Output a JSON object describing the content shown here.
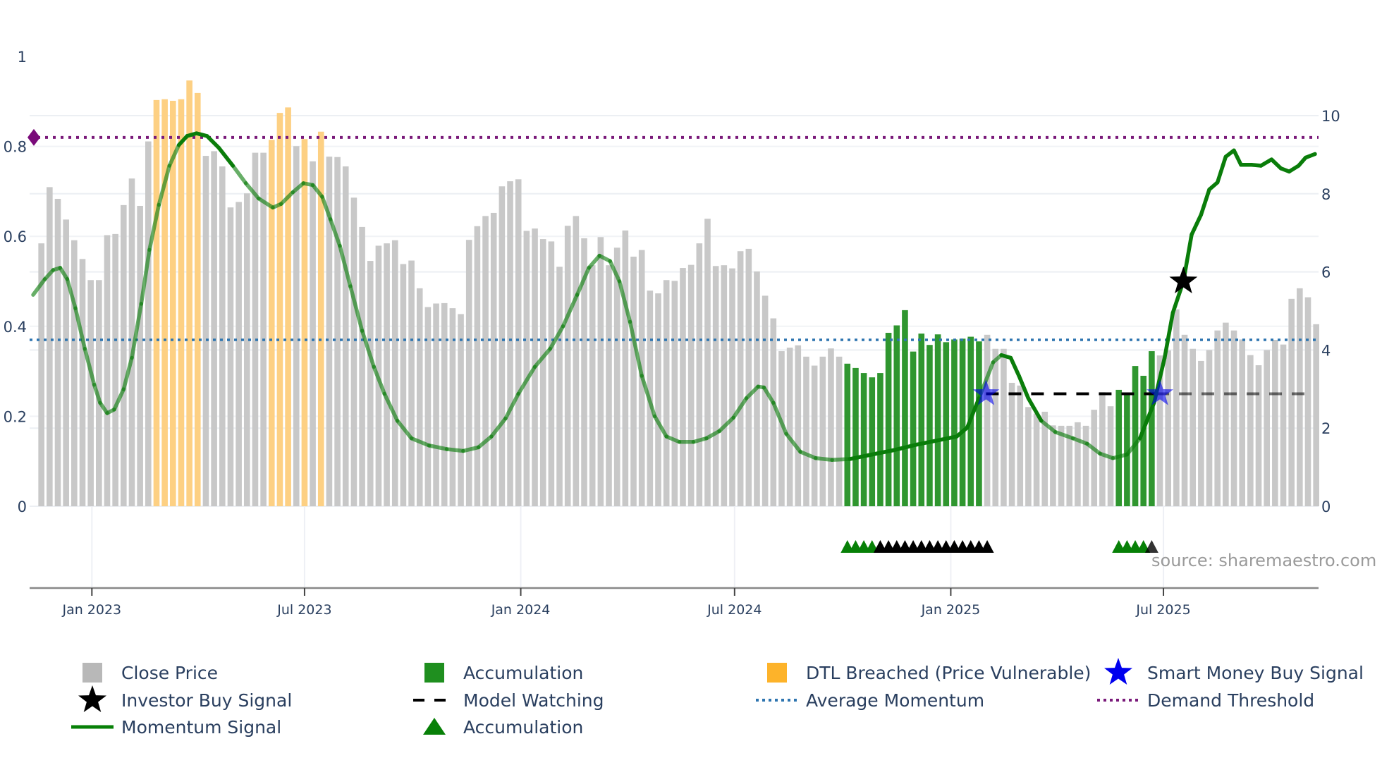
{
  "chart_data": {
    "type": "bar",
    "title": "",
    "source_note": "source: sharemaestro.com",
    "x_range": [
      "2022-11-09",
      "2025-11-10"
    ],
    "x_ticks": [
      {
        "date": "2023-01-01",
        "label": "Jan 2023"
      },
      {
        "date": "2023-07-01",
        "label": "Jul 2023"
      },
      {
        "date": "2024-01-01",
        "label": "Jan 2024"
      },
      {
        "date": "2024-07-01",
        "label": "Jul 2024"
      },
      {
        "date": "2025-01-01",
        "label": "Jan 2025"
      },
      {
        "date": "2025-07-01",
        "label": "Jul 2025"
      }
    ],
    "y_left": {
      "range": [
        0,
        1
      ],
      "ticks": [
        0,
        0.2,
        0.4,
        0.6,
        0.8,
        1
      ],
      "tick_labels": [
        "0",
        "0.2",
        "0.4",
        "0.6",
        "0.8",
        "1"
      ]
    },
    "y_right": {
      "range": [
        0,
        11.5
      ],
      "ticks": [
        0,
        2,
        4,
        6,
        8,
        10
      ],
      "tick_labels": [
        "0",
        "2",
        "4",
        "6",
        "8",
        "10"
      ]
    },
    "close_price": {
      "axis": "right",
      "start_date": "2022-11-19",
      "step_days": 7,
      "values": [
        6.73,
        8.17,
        7.87,
        7.34,
        6.81,
        6.33,
        5.79,
        5.79,
        6.94,
        6.97,
        7.71,
        8.39,
        7.69,
        9.34,
        10.4,
        10.42,
        10.38,
        10.42,
        10.9,
        10.58,
        8.97,
        9.09,
        8.7,
        7.65,
        7.79,
        8.01,
        9.05,
        9.05,
        9.38,
        10.07,
        10.21,
        9.22,
        9.4,
        8.83,
        9.59,
        8.95,
        8.94,
        8.7,
        7.9,
        7.15,
        6.28,
        6.67,
        6.73,
        6.81,
        6.2,
        6.29,
        5.58,
        5.1,
        5.19,
        5.2,
        5.07,
        4.92,
        6.82,
        7.17,
        7.43,
        7.51,
        8.19,
        8.32,
        8.37,
        7.05,
        7.11,
        6.84,
        6.78,
        6.13,
        7.18,
        7.43,
        6.86,
        6.17,
        6.89,
        6.17,
        6.62,
        7.06,
        6.39,
        6.56,
        5.52,
        5.45,
        5.79,
        5.77,
        6.1,
        6.18,
        6.73,
        7.36,
        6.15,
        6.17,
        6.09,
        6.53,
        6.59,
        6.01,
        5.39,
        4.81,
        3.97,
        4.06,
        4.12,
        3.83,
        3.6,
        3.83,
        4.04,
        3.83,
        3.65,
        3.54,
        3.41,
        3.3,
        3.41,
        4.44,
        4.63,
        5.02,
        3.96,
        4.42,
        4.13,
        4.4,
        4.2,
        4.27,
        4.29,
        4.34,
        4.22,
        4.39,
        4.03,
        4.03,
        3.16,
        3.09,
        2.54,
        2.37,
        2.42,
        2.07,
        2.06,
        2.06,
        2.15,
        2.06,
        2.47,
        2.92,
        2.56,
        2.98,
        2.89,
        3.59,
        3.34,
        3.97,
        3.86,
        3.99,
        5.04,
        4.39,
        4.03,
        3.72,
        4.0,
        4.5,
        4.7,
        4.5,
        4.27,
        3.87,
        3.61,
        4.0,
        4.26,
        4.14,
        5.31,
        5.58,
        5.35,
        4.66
      ],
      "dtl_breached_indices": [
        14,
        15,
        16,
        17,
        18,
        19,
        28,
        29,
        30,
        32,
        34
      ],
      "accumulation_indices": [
        98,
        99,
        100,
        101,
        102,
        103,
        104,
        105,
        106,
        107,
        108,
        109,
        110,
        111,
        112,
        113,
        114,
        131,
        132,
        133,
        134,
        135
      ]
    },
    "accumulation_markers": {
      "green_indices": [
        98,
        99,
        100,
        101,
        131,
        132,
        133,
        134
      ],
      "black_indices": [
        102,
        103,
        104,
        105,
        106,
        107,
        108,
        109,
        110,
        111,
        112,
        113,
        114,
        115,
        135
      ]
    },
    "momentum_signal": {
      "axis": "left",
      "points": [
        [
          "2022-11-12",
          0.47
        ],
        [
          "2022-11-22",
          0.505
        ],
        [
          "2022-11-29",
          0.525
        ],
        [
          "2022-12-05",
          0.53
        ],
        [
          "2022-12-11",
          0.505
        ],
        [
          "2022-12-18",
          0.44
        ],
        [
          "2022-12-26",
          0.35
        ],
        [
          "2023-01-03",
          0.27
        ],
        [
          "2023-01-08",
          0.23
        ],
        [
          "2023-01-14",
          0.207
        ],
        [
          "2023-01-20",
          0.215
        ],
        [
          "2023-01-28",
          0.26
        ],
        [
          "2023-02-04",
          0.33
        ],
        [
          "2023-02-12",
          0.45
        ],
        [
          "2023-02-19",
          0.57
        ],
        [
          "2023-02-27",
          0.67
        ],
        [
          "2023-03-08",
          0.757
        ],
        [
          "2023-03-16",
          0.803
        ],
        [
          "2023-03-23",
          0.823
        ],
        [
          "2023-03-31",
          0.829
        ],
        [
          "2023-04-09",
          0.823
        ],
        [
          "2023-04-19",
          0.797
        ],
        [
          "2023-05-01",
          0.757
        ],
        [
          "2023-05-12",
          0.718
        ],
        [
          "2023-05-23",
          0.684
        ],
        [
          "2023-06-04",
          0.664
        ],
        [
          "2023-06-11",
          0.672
        ],
        [
          "2023-06-21",
          0.698
        ],
        [
          "2023-06-30",
          0.718
        ],
        [
          "2023-07-08",
          0.714
        ],
        [
          "2023-07-16",
          0.688
        ],
        [
          "2023-07-23",
          0.638
        ],
        [
          "2023-07-31",
          0.579
        ],
        [
          "2023-08-09",
          0.489
        ],
        [
          "2023-08-19",
          0.39
        ],
        [
          "2023-08-29",
          0.31
        ],
        [
          "2023-09-07",
          0.25
        ],
        [
          "2023-09-18",
          0.19
        ],
        [
          "2023-09-30",
          0.151
        ],
        [
          "2023-10-15",
          0.135
        ],
        [
          "2023-10-30",
          0.127
        ],
        [
          "2023-11-13",
          0.123
        ],
        [
          "2023-11-26",
          0.131
        ],
        [
          "2023-12-07",
          0.155
        ],
        [
          "2023-12-19",
          0.195
        ],
        [
          "2023-12-30",
          0.25
        ],
        [
          "2024-01-13",
          0.31
        ],
        [
          "2024-01-26",
          0.35
        ],
        [
          "2024-02-06",
          0.4
        ],
        [
          "2024-02-18",
          0.47
        ],
        [
          "2024-02-28",
          0.53
        ],
        [
          "2024-03-08",
          0.557
        ],
        [
          "2024-03-17",
          0.545
        ],
        [
          "2024-03-25",
          0.5
        ],
        [
          "2024-04-03",
          0.41
        ],
        [
          "2024-04-13",
          0.29
        ],
        [
          "2024-04-24",
          0.2
        ],
        [
          "2024-05-04",
          0.155
        ],
        [
          "2024-05-15",
          0.143
        ],
        [
          "2024-05-27",
          0.143
        ],
        [
          "2024-06-07",
          0.151
        ],
        [
          "2024-06-18",
          0.167
        ],
        [
          "2024-06-30",
          0.197
        ],
        [
          "2024-07-11",
          0.24
        ],
        [
          "2024-07-21",
          0.266
        ],
        [
          "2024-07-26",
          0.264
        ],
        [
          "2024-08-03",
          0.23
        ],
        [
          "2024-08-14",
          0.161
        ],
        [
          "2024-08-26",
          0.121
        ],
        [
          "2024-09-08",
          0.107
        ],
        [
          "2024-09-22",
          0.103
        ],
        [
          "2024-10-07",
          0.105
        ],
        [
          "2024-10-26",
          0.115
        ],
        [
          "2024-11-14",
          0.125
        ],
        [
          "2024-12-03",
          0.137
        ],
        [
          "2024-12-22",
          0.147
        ],
        [
          "2025-01-06",
          0.155
        ],
        [
          "2025-01-15",
          0.175
        ],
        [
          "2025-01-25",
          0.24
        ],
        [
          "2025-02-06",
          0.32
        ],
        [
          "2025-02-13",
          0.336
        ],
        [
          "2025-02-21",
          0.33
        ],
        [
          "2025-02-28",
          0.29
        ],
        [
          "2025-03-08",
          0.24
        ],
        [
          "2025-03-19",
          0.19
        ],
        [
          "2025-03-31",
          0.165
        ],
        [
          "2025-04-15",
          0.151
        ],
        [
          "2025-04-27",
          0.139
        ],
        [
          "2025-05-08",
          0.117
        ],
        [
          "2025-05-19",
          0.107
        ],
        [
          "2025-05-31",
          0.115
        ],
        [
          "2025-06-11",
          0.151
        ],
        [
          "2025-06-23",
          0.23
        ],
        [
          "2025-07-02",
          0.33
        ],
        [
          "2025-07-09",
          0.43
        ],
        [
          "2025-07-18",
          0.5
        ],
        [
          "2025-07-25",
          0.604
        ],
        [
          "2025-08-02",
          0.648
        ],
        [
          "2025-08-09",
          0.704
        ],
        [
          "2025-08-16",
          0.72
        ],
        [
          "2025-08-23",
          0.777
        ],
        [
          "2025-08-30",
          0.791
        ],
        [
          "2025-09-05",
          0.759
        ],
        [
          "2025-09-14",
          0.759
        ],
        [
          "2025-09-22",
          0.757
        ],
        [
          "2025-10-01",
          0.771
        ],
        [
          "2025-10-09",
          0.751
        ],
        [
          "2025-10-16",
          0.744
        ],
        [
          "2025-10-24",
          0.757
        ],
        [
          "2025-10-30",
          0.775
        ],
        [
          "2025-11-07",
          0.783
        ]
      ],
      "strong_ranges": [
        [
          "2023-03-16",
          "2023-04-25"
        ],
        [
          "2024-10-07",
          "2025-01-20"
        ],
        [
          "2025-02-13",
          "2025-03-15"
        ],
        [
          "2025-06-11",
          "2025-11-07"
        ]
      ]
    },
    "average_momentum": 0.37,
    "demand_threshold": 0.82,
    "model_watching": {
      "axis": "right",
      "value": 2.88,
      "start": "2025-01-31",
      "end": "2025-11-03",
      "faded_after": "2025-06-25"
    },
    "smart_money_buy_signals": [
      {
        "date": "2025-01-31",
        "value": 2.88
      },
      {
        "date": "2025-06-28",
        "value": 2.88
      }
    ],
    "investor_buy_signals": [
      {
        "date": "2025-07-18",
        "value": 0.5
      }
    ],
    "colors": {
      "close_price": "#c8c8c8",
      "dtl_breached": "#fdd083",
      "accumulation": "#2f962f",
      "momentum": "#0a7d0a",
      "average_momentum": "#2e75b0",
      "demand_threshold": "#7a1a7a",
      "model_watching": "#000000",
      "smart_money": "#0000ee",
      "investor": "#000000",
      "acc_marker": "#078007"
    },
    "legend": [
      {
        "label": "Close Price",
        "icon": "gray-square"
      },
      {
        "label": "Accumulation",
        "icon": "green-square"
      },
      {
        "label": "DTL Breached (Price Vulnerable)",
        "icon": "orange-square"
      },
      {
        "label": "Smart Money Buy Signal",
        "icon": "blue-star"
      },
      {
        "label": "Investor Buy Signal",
        "icon": "black-star"
      },
      {
        "label": "Model Watching",
        "icon": "black-dash-line"
      },
      {
        "label": "Average Momentum",
        "icon": "blue-dot-line"
      },
      {
        "label": "Demand Threshold",
        "icon": "purple-dot-line"
      },
      {
        "label": "Momentum Signal",
        "icon": "green-line"
      },
      {
        "label": "Accumulation",
        "icon": "green-triangle"
      }
    ]
  }
}
